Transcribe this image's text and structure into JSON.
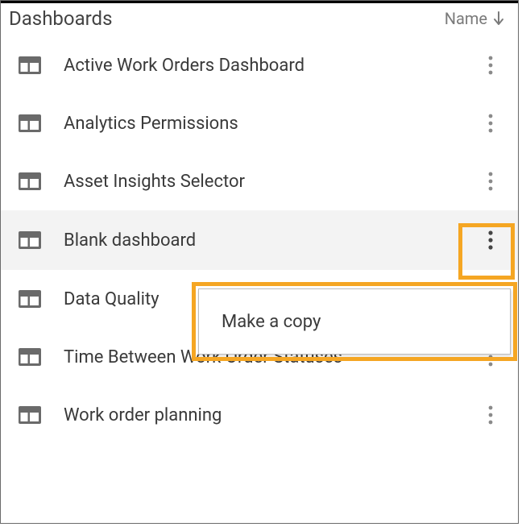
{
  "header": {
    "title": "Dashboards",
    "sort_label": "Name",
    "sort_direction": "down"
  },
  "rows": [
    {
      "label": "Active Work Orders Dashboard",
      "selected": false,
      "menu_open": false
    },
    {
      "label": "Analytics Permissions",
      "selected": false,
      "menu_open": false
    },
    {
      "label": "Asset Insights Selector",
      "selected": false,
      "menu_open": false
    },
    {
      "label": "Blank dashboard",
      "selected": true,
      "menu_open": true
    },
    {
      "label": "Data Quality",
      "selected": false,
      "menu_open": false
    },
    {
      "label": "Time Between Work Order Statuses",
      "selected": false,
      "menu_open": false
    },
    {
      "label": "Work order planning",
      "selected": false,
      "menu_open": false
    }
  ],
  "menu": {
    "items": [
      {
        "label": "Make a copy"
      }
    ]
  },
  "colors": {
    "highlight": "#f5a623",
    "icon": "#6a6a6a",
    "text": "#3a3a3a",
    "muted": "#7a7a7a",
    "selected_bg": "#f3f3f3"
  }
}
